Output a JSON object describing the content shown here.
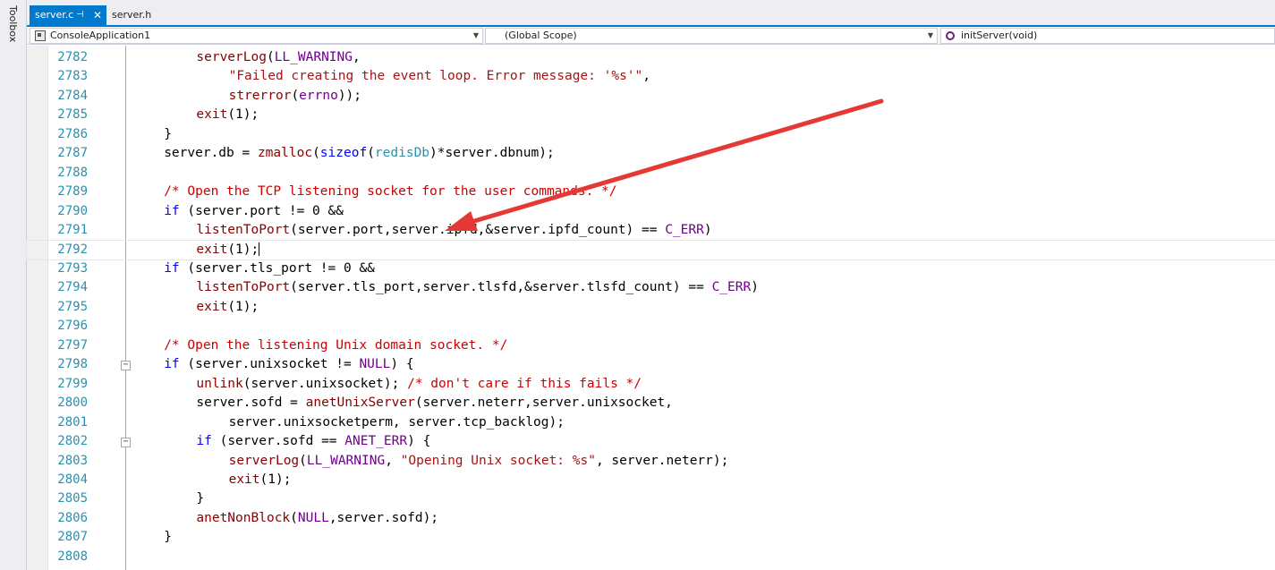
{
  "toolbox": {
    "label": "Toolbox"
  },
  "tabs": [
    {
      "label": "server.c",
      "active": true,
      "pin_icon": "pin-icon",
      "close_icon": "close-icon"
    },
    {
      "label": "server.h",
      "active": false
    }
  ],
  "navbar": {
    "project": "ConsoleApplication1",
    "scope": "(Global Scope)",
    "function": "initServer(void)"
  },
  "colors": {
    "accent": "#007acc",
    "line_number": "#2b91af",
    "keyword": "#0000ff",
    "function": "#880000",
    "string": "#a31515",
    "comment": "#cc0000",
    "macro": "#6f008a",
    "annotation_arrow": "#e53935"
  },
  "editor": {
    "current_line": "2792",
    "lines": [
      {
        "num": "2782",
        "text": "serverLog(LL_WARNING,"
      },
      {
        "num": "2783",
        "text": "\"Failed creating the event loop. Error message: '%s'\","
      },
      {
        "num": "2784",
        "text": "strerror(errno));"
      },
      {
        "num": "2785",
        "text": "exit(1);"
      },
      {
        "num": "2786",
        "text": "}"
      },
      {
        "num": "2787",
        "text": "server.db = zmalloc(sizeof(redisDb)*server.dbnum);"
      },
      {
        "num": "2788",
        "text": ""
      },
      {
        "num": "2789",
        "text": "/* Open the TCP listening socket for the user commands. */"
      },
      {
        "num": "2790",
        "text": "if (server.port != 0 &&"
      },
      {
        "num": "2791",
        "text": "listenToPort(server.port,server.ipfd,&server.ipfd_count) == C_ERR)"
      },
      {
        "num": "2792",
        "text": "exit(1);"
      },
      {
        "num": "2793",
        "text": "if (server.tls_port != 0 &&"
      },
      {
        "num": "2794",
        "text": "listenToPort(server.tls_port,server.tlsfd,&server.tlsfd_count) == C_ERR)"
      },
      {
        "num": "2795",
        "text": "exit(1);"
      },
      {
        "num": "2796",
        "text": ""
      },
      {
        "num": "2797",
        "text": "/* Open the listening Unix domain socket. */"
      },
      {
        "num": "2798",
        "text": "if (server.unixsocket != NULL) {"
      },
      {
        "num": "2799",
        "text": "unlink(server.unixsocket); /* don't care if this fails */"
      },
      {
        "num": "2800",
        "text": "server.sofd = anetUnixServer(server.neterr,server.unixsocket,"
      },
      {
        "num": "2801",
        "text": "server.unixsocketperm, server.tcp_backlog);"
      },
      {
        "num": "2802",
        "text": "if (server.sofd == ANET_ERR) {"
      },
      {
        "num": "2803",
        "text": "serverLog(LL_WARNING, \"Opening Unix socket: %s\", server.neterr);"
      },
      {
        "num": "2804",
        "text": "exit(1);"
      },
      {
        "num": "2805",
        "text": "}"
      },
      {
        "num": "2806",
        "text": "anetNonBlock(NULL,server.sofd);"
      },
      {
        "num": "2807",
        "text": "}"
      },
      {
        "num": "2808",
        "text": ""
      }
    ]
  }
}
